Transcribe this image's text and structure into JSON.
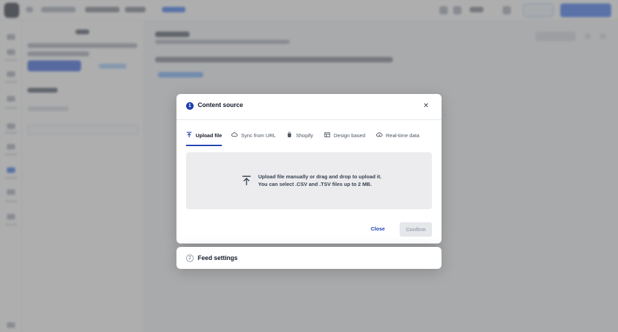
{
  "modal": {
    "step_number": "1",
    "title": "Content source",
    "close_symbol": "✕",
    "tabs": [
      {
        "label": "Upload file",
        "icon": "upload-icon",
        "active": true
      },
      {
        "label": "Sync from URL",
        "icon": "cloud-sync-icon",
        "active": false
      },
      {
        "label": "Shopify",
        "icon": "shopify-bag-icon",
        "active": false
      },
      {
        "label": "Design based",
        "icon": "layout-icon",
        "active": false
      },
      {
        "label": "Real-time data",
        "icon": "cloud-realtime-icon",
        "active": false
      }
    ],
    "dropzone": {
      "line1": "Upload file manually or drag and drop to upload it.",
      "line2": "You can select .CSV and .TSV files up to 2 MB."
    },
    "close_label": "Close",
    "confirm_label": "Confirm"
  },
  "next_step": {
    "step_number": "2",
    "title": "Feed settings"
  },
  "colors": {
    "accent": "#1e40af",
    "overlay": "rgba(0,0,0,0.30)",
    "dropzone_bg": "#ececee",
    "disabled_bg": "#e5e7eb"
  }
}
